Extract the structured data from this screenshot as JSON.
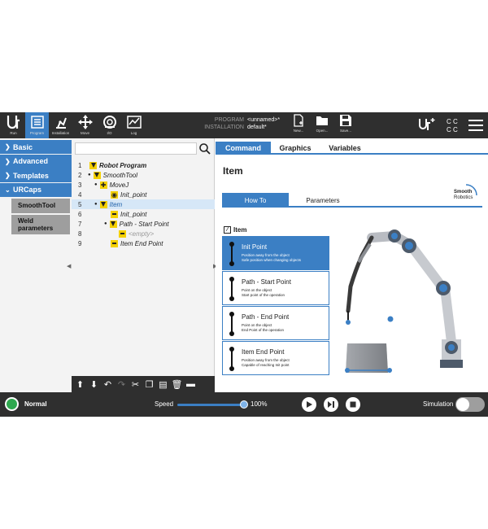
{
  "topbar": {
    "nav": [
      {
        "label": "Run",
        "icon": "ur-logo-icon"
      },
      {
        "label": "Program",
        "icon": "program-icon",
        "active": true
      },
      {
        "label": "Installation",
        "icon": "installation-icon"
      },
      {
        "label": "Move",
        "icon": "move-icon"
      },
      {
        "label": "I/O",
        "icon": "io-icon"
      },
      {
        "label": "Log",
        "icon": "log-icon"
      }
    ],
    "program_key": "PROGRAM",
    "program_val": "<unnamed>*",
    "installation_key": "INSTALLATION",
    "installation_val": "default*",
    "file": [
      {
        "label": "New..."
      },
      {
        "label": "Open..."
      },
      {
        "label": "Save..."
      }
    ],
    "cc": "C C\nC C"
  },
  "sidebar": {
    "items": [
      {
        "label": "Basic"
      },
      {
        "label": "Advanced"
      },
      {
        "label": "Templates"
      },
      {
        "label": "URCaps"
      }
    ],
    "sub": [
      {
        "label": "SmoothTool"
      },
      {
        "label": "Weld parameters"
      }
    ]
  },
  "tree": {
    "rows": [
      {
        "num": "1",
        "label": "Robot Program"
      },
      {
        "num": "2",
        "label": "SmoothTool"
      },
      {
        "num": "3",
        "label": "MoveJ"
      },
      {
        "num": "4",
        "label": "Init_point"
      },
      {
        "num": "5",
        "label": "Item"
      },
      {
        "num": "6",
        "label": "Init_point"
      },
      {
        "num": "7",
        "label": "Path - Start Point"
      },
      {
        "num": "8",
        "label": "<empty>"
      },
      {
        "num": "9",
        "label": "Item End Point"
      }
    ]
  },
  "main": {
    "tabs": [
      {
        "label": "Command"
      },
      {
        "label": "Graphics"
      },
      {
        "label": "Variables"
      }
    ],
    "title": "Item",
    "subtabs": [
      {
        "label": "How To"
      },
      {
        "label": "Parameters"
      }
    ],
    "logo_line1": "Smooth",
    "logo_line2": "Robotics",
    "section": "Item",
    "cards": [
      {
        "title": "Init Point",
        "l1": "Position away from the object",
        "l2": "Safe position when changing objects"
      },
      {
        "title": "Path - Start Point",
        "l1": "Point on the object",
        "l2": "Start point of the operation"
      },
      {
        "title": "Path - End Point",
        "l1": "Point on the object",
        "l2": "End Point of the operation"
      },
      {
        "title": "Item End Point",
        "l1": "Position away from the object",
        "l2": "Capable of reaching Init point"
      }
    ]
  },
  "bottombar": {
    "status": "Normal",
    "speed_label": "Speed",
    "speed_value": "100%",
    "speed_fraction": 1.0,
    "simulation_label": "Simulation"
  },
  "colors": {
    "accent": "#3b7fc4",
    "bar": "#2f2f2f",
    "ok": "#2fa84f",
    "node": "#f4d000"
  }
}
